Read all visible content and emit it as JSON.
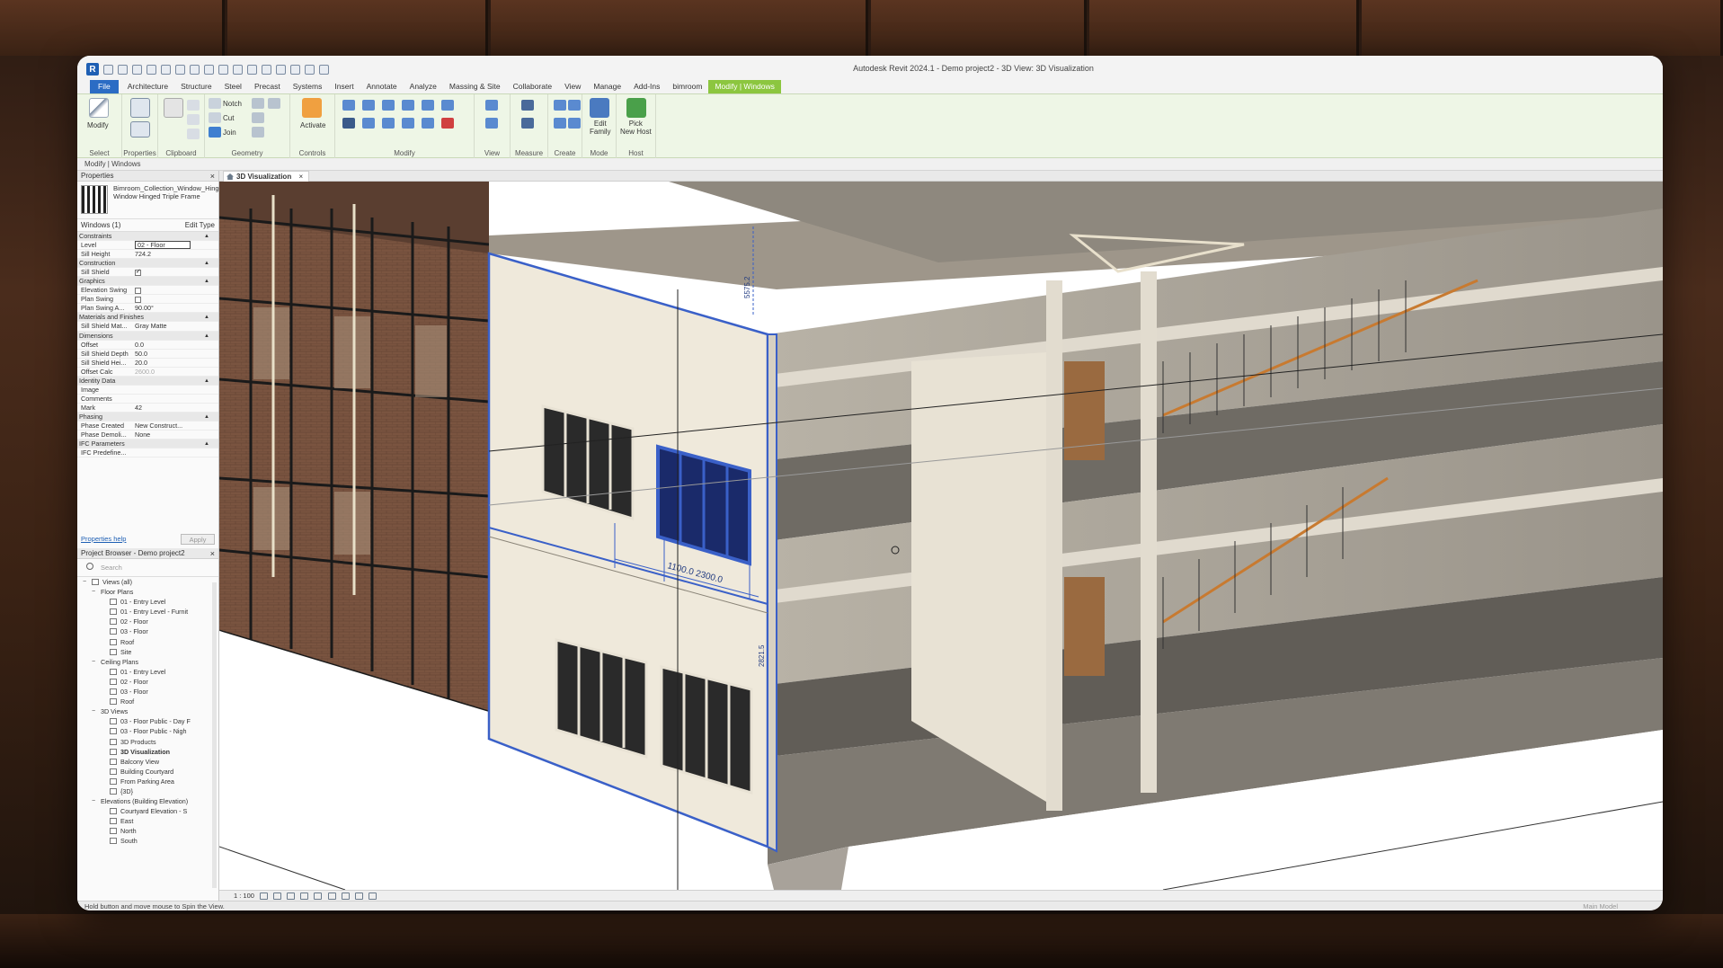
{
  "app": {
    "window_title": "Autodesk Revit 2024.1 - Demo project2 - 3D View: 3D Visualization",
    "logo_letter": "R"
  },
  "ribbon_tabs": [
    "File",
    "Architecture",
    "Structure",
    "Steel",
    "Precast",
    "Systems",
    "Insert",
    "Annotate",
    "Analyze",
    "Massing & Site",
    "Collaborate",
    "View",
    "Manage",
    "Add-Ins",
    "bimroom",
    "Modify | Windows"
  ],
  "ribbon": {
    "modify_label": "Modify",
    "select_label": "Select",
    "properties_label": "Properties",
    "clipboard_label": "Clipboard",
    "geometry_label": "Geometry",
    "controls_label": "Controls",
    "modify_group_label": "Modify",
    "view_label": "View",
    "measure_label": "Measure",
    "create_label": "Create",
    "mode_label": "Mode",
    "host_label": "Host",
    "notch_label": "Notch",
    "cut_label": "Cut",
    "join_label": "Join",
    "activate_label": "Activate",
    "edit_family_label": "Edit\nFamily",
    "pick_new_host_label": "Pick\nNew Host"
  },
  "modify_bar": "Modify | Windows",
  "properties": {
    "title": "Properties",
    "type_name": "Bimroom_Collection_Window_Hinged_Triple_... Window Hinged Triple Frame",
    "instance_filter": "Windows (1)",
    "edit_type": "Edit Type",
    "rows": [
      {
        "cat": "Constraints"
      },
      {
        "name": "Level",
        "value": "02 - Floor",
        "edit": true
      },
      {
        "name": "Sill Height",
        "value": "724.2"
      },
      {
        "cat": "Construction"
      },
      {
        "name": "Sill Shield",
        "check": true
      },
      {
        "cat": "Graphics"
      },
      {
        "name": "Elevation Swing",
        "check": false
      },
      {
        "name": "Plan Swing",
        "check": false
      },
      {
        "name": "Plan Swing A...",
        "value": "90.00°"
      },
      {
        "cat": "Materials and Finishes"
      },
      {
        "name": "Sill Shield Mat...",
        "value": "Gray Matte"
      },
      {
        "cat": "Dimensions"
      },
      {
        "name": "Offset",
        "value": "0.0"
      },
      {
        "name": "Sill Shield Depth",
        "value": "50.0"
      },
      {
        "name": "Sill Shield Hei...",
        "value": "20.0"
      },
      {
        "name": "Offset Calc",
        "value": "2600.0",
        "muted": true
      },
      {
        "cat": "Identity Data"
      },
      {
        "name": "Image",
        "value": ""
      },
      {
        "name": "Comments",
        "value": ""
      },
      {
        "name": "Mark",
        "value": "42"
      },
      {
        "cat": "Phasing"
      },
      {
        "name": "Phase Created",
        "value": "New Construct..."
      },
      {
        "name": "Phase Demoli...",
        "value": "None"
      },
      {
        "cat": "IFC Parameters"
      },
      {
        "name": "IFC Predefine...",
        "value": ""
      }
    ],
    "help_link": "Properties help",
    "apply": "Apply"
  },
  "browser": {
    "title": "Project Browser - Demo project2",
    "search_placeholder": "Search",
    "nodes": [
      {
        "level": 0,
        "label": "Views (all)",
        "exp": "−"
      },
      {
        "level": 1,
        "label": "Floor Plans",
        "exp": "−"
      },
      {
        "level": 2,
        "label": "01 - Entry Level"
      },
      {
        "level": 2,
        "label": "01 - Entry Level - Furnit"
      },
      {
        "level": 2,
        "label": "02 - Floor"
      },
      {
        "level": 2,
        "label": "03 - Floor"
      },
      {
        "level": 2,
        "label": "Roof"
      },
      {
        "level": 2,
        "label": "Site"
      },
      {
        "level": 1,
        "label": "Ceiling Plans",
        "exp": "−"
      },
      {
        "level": 2,
        "label": "01 - Entry Level"
      },
      {
        "level": 2,
        "label": "02 - Floor"
      },
      {
        "level": 2,
        "label": "03 - Floor"
      },
      {
        "level": 2,
        "label": "Roof"
      },
      {
        "level": 1,
        "label": "3D Views",
        "exp": "−"
      },
      {
        "level": 2,
        "label": "03 - Floor Public - Day F"
      },
      {
        "level": 2,
        "label": "03 - Floor Public - Nigh"
      },
      {
        "level": 2,
        "label": "3D Products"
      },
      {
        "level": 2,
        "label": "3D Visualization",
        "selected": true
      },
      {
        "level": 2,
        "label": "Balcony View"
      },
      {
        "level": 2,
        "label": "Building Courtyard"
      },
      {
        "level": 2,
        "label": "From Parking Area"
      },
      {
        "level": 2,
        "label": "{3D}"
      },
      {
        "level": 1,
        "label": "Elevations (Building Elevation)",
        "exp": "−"
      },
      {
        "level": 2,
        "label": "Courtyard Elevation - S"
      },
      {
        "level": 2,
        "label": "East"
      },
      {
        "level": 2,
        "label": "North"
      },
      {
        "level": 2,
        "label": "South"
      }
    ]
  },
  "view": {
    "tab_label": "3D Visualization",
    "scale": "1 : 100",
    "dim_label_1": "1100.0 2300.0",
    "dim_label_2": "5575.2",
    "dim_label_3": "2821.5"
  },
  "statusbar": {
    "hint": "Hold button and move mouse to Spin the View.",
    "main_model": "Main Model"
  }
}
